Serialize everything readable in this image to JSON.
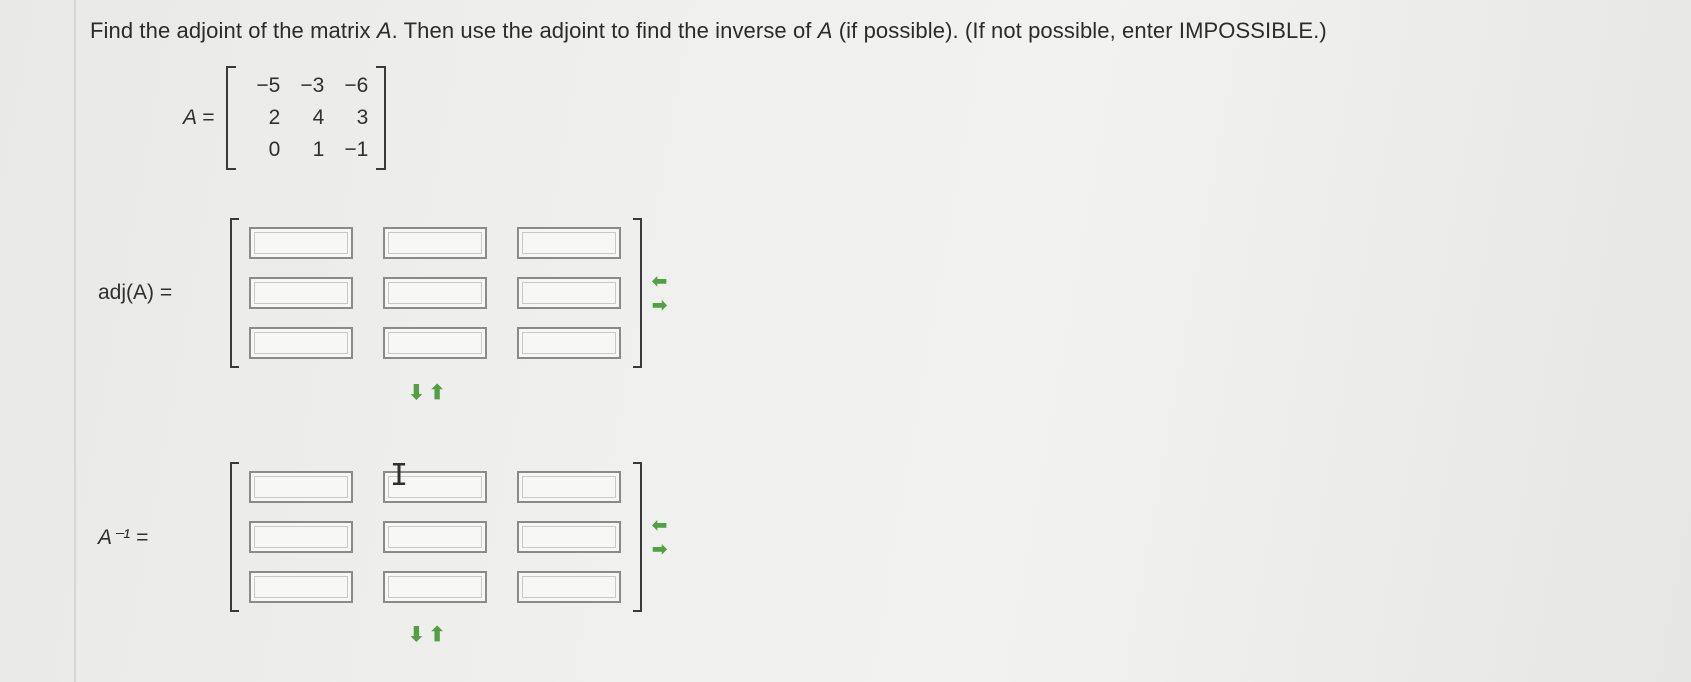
{
  "question": {
    "part1": "Find the adjoint of the matrix ",
    "var_a": "A",
    "part2": ". Then use the adjoint to find the inverse of ",
    "var_a2": "A",
    "part3": " (if possible). (If not possible, enter IMPOSSIBLE.)"
  },
  "given_matrix": {
    "label": "A =",
    "rows": [
      [
        "−5",
        "−3",
        "−6"
      ],
      [
        "2",
        "4",
        "3"
      ],
      [
        "0",
        "1",
        "−1"
      ]
    ]
  },
  "adjoint": {
    "label": "adj(A) =",
    "cells": [
      [
        "",
        "",
        ""
      ],
      [
        "",
        "",
        ""
      ],
      [
        "",
        "",
        ""
      ]
    ],
    "column_arrows": "←\n→",
    "row_arrows": "↓↑"
  },
  "inverse": {
    "label": "A⁻¹ =",
    "cells": [
      [
        "",
        "",
        ""
      ],
      [
        "",
        "",
        ""
      ],
      [
        "",
        "",
        ""
      ]
    ],
    "column_arrows": "←\n→",
    "row_arrows": "↓↑"
  },
  "icons": {
    "add_remove_column": "left-right-arrows-icon",
    "add_remove_row": "down-up-arrows-icon",
    "text_cursor": "ibeam-cursor-icon"
  },
  "colors": {
    "arrow_green": "#52a043",
    "cell_border": "#8a8a8a"
  }
}
